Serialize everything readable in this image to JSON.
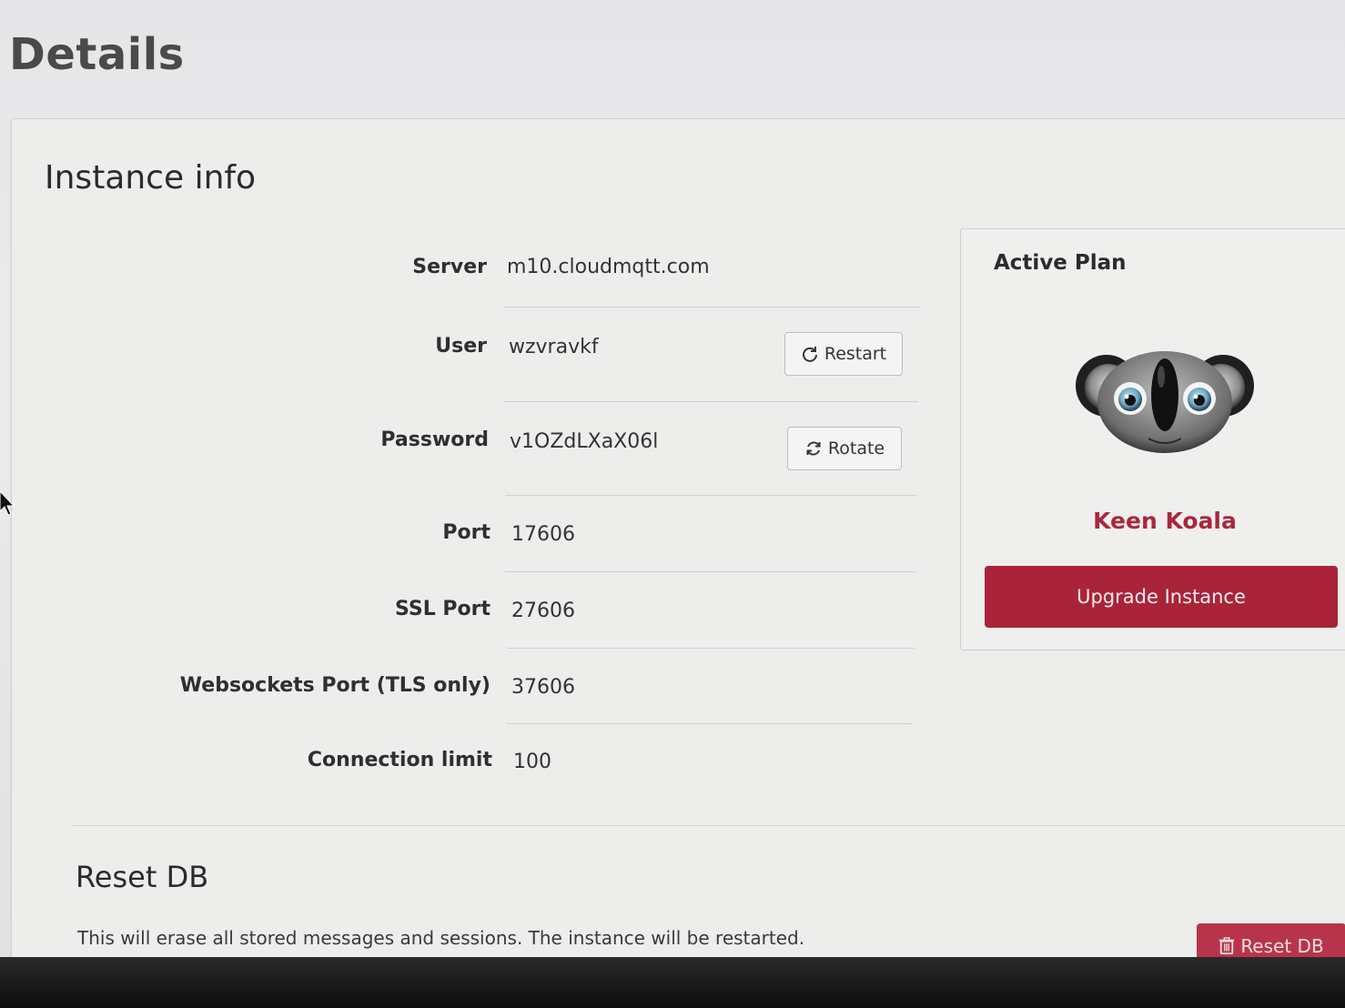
{
  "page": {
    "title": "Details"
  },
  "instance_info": {
    "title": "Instance info",
    "rows": [
      {
        "label": "Server",
        "value": "m10.cloudmqtt.com"
      },
      {
        "label": "User",
        "value": "wzvravkf"
      },
      {
        "label": "Password",
        "value": "v1OZdLXaX06l"
      },
      {
        "label": "Port",
        "value": "17606"
      },
      {
        "label": "SSL Port",
        "value": "27606"
      },
      {
        "label": "Websockets Port (TLS only)",
        "value": "37606"
      },
      {
        "label": "Connection limit",
        "value": "100"
      }
    ],
    "restart_label": "Restart",
    "rotate_label": "Rotate"
  },
  "active_plan": {
    "title": "Active Plan",
    "plan_name": "Keen Koala",
    "upgrade_label": "Upgrade Instance",
    "plan_icon": "koala-icon"
  },
  "reset_db": {
    "title": "Reset DB",
    "description": "This will erase all stored messages and sessions. The instance will be restarted.",
    "button_label": "Reset DB",
    "button_icon": "trash-icon"
  },
  "colors": {
    "accent": "#a92439",
    "plan_name": "#a8283e",
    "background": "#ededec"
  }
}
